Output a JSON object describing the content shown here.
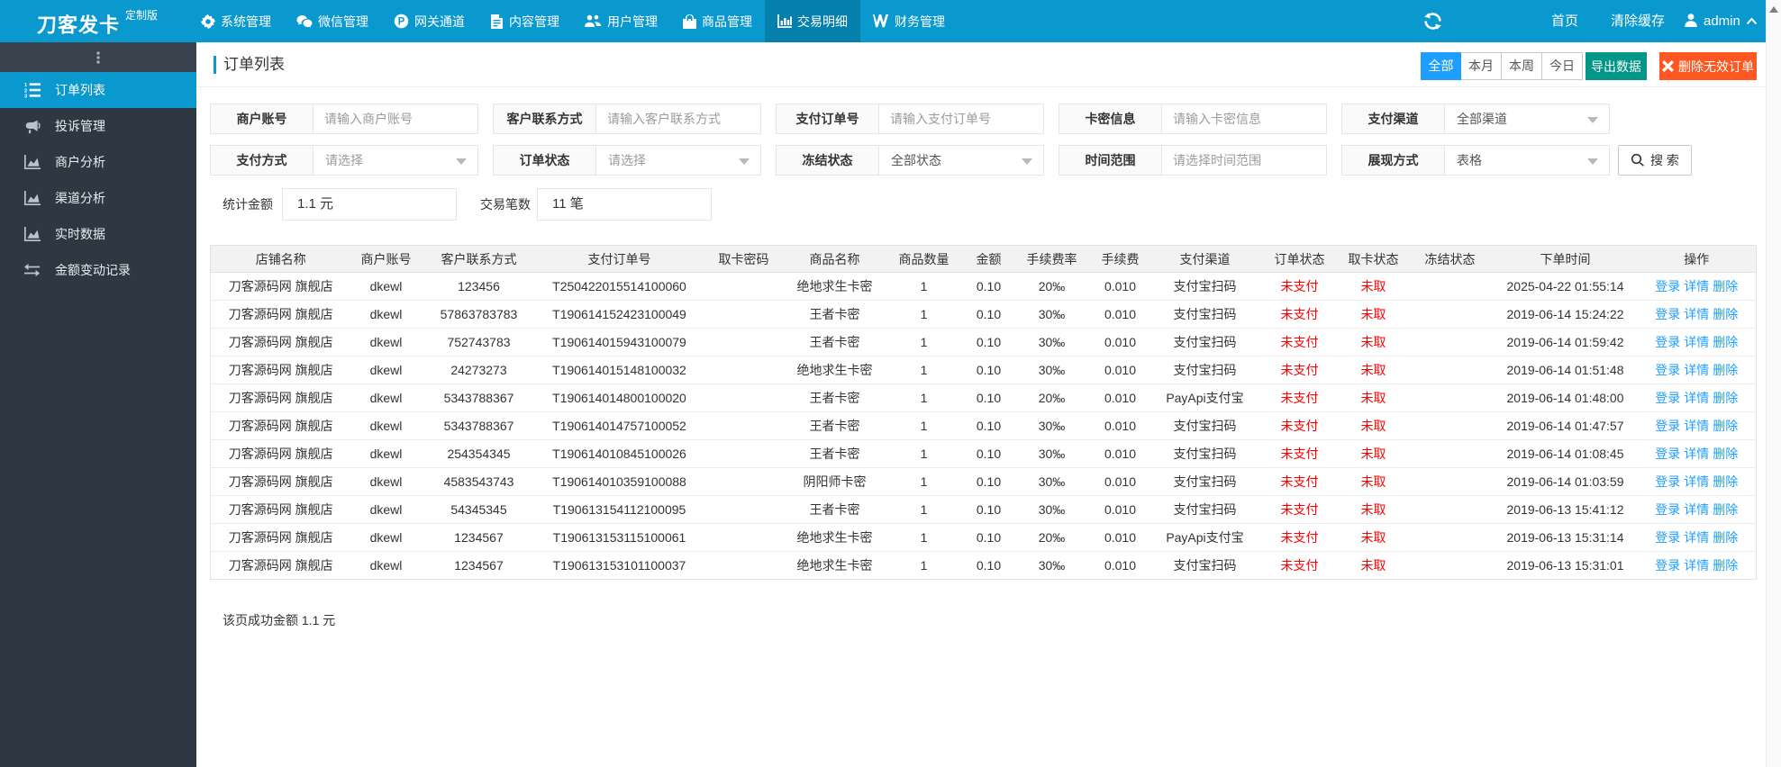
{
  "topbar": {
    "logo": "刀客发卡",
    "logo_badge": "定制版",
    "nav": [
      {
        "label": "系统管理",
        "icon": "gear-icon",
        "active": false
      },
      {
        "label": "微信管理",
        "icon": "wechat-icon",
        "active": false
      },
      {
        "label": "网关通道",
        "icon": "gateway-p-icon",
        "active": false
      },
      {
        "label": "内容管理",
        "icon": "document-icon",
        "active": false
      },
      {
        "label": "用户管理",
        "icon": "users-icon",
        "active": false
      },
      {
        "label": "商品管理",
        "icon": "shopping-bag-icon",
        "active": false
      },
      {
        "label": "交易明细",
        "icon": "bar-chart-icon",
        "active": true
      },
      {
        "label": "财务管理",
        "icon": "finance-icon",
        "active": false
      }
    ],
    "right": {
      "home": "首页",
      "clear_cache": "清除缓存",
      "username": "admin"
    }
  },
  "sidebar": {
    "items": [
      {
        "label": "订单列表",
        "icon": "ordered-list-icon",
        "active": true
      },
      {
        "label": "投诉管理",
        "icon": "megaphone-icon",
        "active": false
      },
      {
        "label": "商户分析",
        "icon": "area-chart-icon",
        "active": false
      },
      {
        "label": "渠道分析",
        "icon": "area-chart-icon",
        "active": false
      },
      {
        "label": "实时数据",
        "icon": "area-chart-icon",
        "active": false
      },
      {
        "label": "金额变动记录",
        "icon": "exchange-icon",
        "active": false
      }
    ]
  },
  "page": {
    "title": "订单列表",
    "range_tabs": [
      {
        "label": "全部",
        "active": true
      },
      {
        "label": "本月",
        "active": false
      },
      {
        "label": "本周",
        "active": false
      },
      {
        "label": "今日",
        "active": false
      }
    ],
    "export_label": "导出数据",
    "delete_label": "删除无效订单",
    "search_label": "搜 索",
    "filters_row1": [
      {
        "label": "商户账号",
        "type": "input",
        "placeholder": "请输入商户账号",
        "value": ""
      },
      {
        "label": "客户联系方式",
        "type": "input",
        "placeholder": "请输入客户联系方式",
        "value": ""
      },
      {
        "label": "支付订单号",
        "type": "input",
        "placeholder": "请输入支付订单号",
        "value": ""
      },
      {
        "label": "卡密信息",
        "type": "input",
        "placeholder": "请输入卡密信息",
        "value": ""
      },
      {
        "label": "支付渠道",
        "type": "select",
        "value": "全部渠道",
        "placeholder_style": false
      }
    ],
    "filters_row2": [
      {
        "label": "支付方式",
        "type": "select",
        "value": "请选择",
        "placeholder_style": true
      },
      {
        "label": "订单状态",
        "type": "select",
        "value": "请选择",
        "placeholder_style": true
      },
      {
        "label": "冻结状态",
        "type": "select",
        "value": "全部状态",
        "placeholder_style": false
      },
      {
        "label": "时间范围",
        "type": "input",
        "placeholder": "请选择时间范围",
        "value": ""
      },
      {
        "label": "展现方式",
        "type": "select",
        "value": "表格",
        "placeholder_style": false
      }
    ],
    "stats": [
      {
        "label": "统计金额",
        "value": "1.1 元"
      },
      {
        "label": "交易笔数",
        "value": "11 笔"
      }
    ],
    "footer_summary": "该页成功金额 1.1 元"
  },
  "table": {
    "columns": [
      "店铺名称",
      "商户账号",
      "客户联系方式",
      "支付订单号",
      "取卡密码",
      "商品名称",
      "商品数量",
      "金额",
      "手续费率",
      "手续费",
      "支付渠道",
      "订单状态",
      "取卡状态",
      "冻结状态",
      "下单时间",
      "操作"
    ],
    "actions": [
      "登录",
      "详情",
      "删除"
    ],
    "rows": [
      [
        "刀客源码网 旗舰店",
        "dkewl",
        "123456",
        "T250422015514100060",
        "",
        "绝地求生卡密",
        "1",
        "0.10",
        "20‰",
        "0.010",
        "支付宝扫码",
        "未支付",
        "未取",
        "",
        "2025-04-22 01:55:14"
      ],
      [
        "刀客源码网 旗舰店",
        "dkewl",
        "57863783783",
        "T190614152423100049",
        "",
        "王者卡密",
        "1",
        "0.10",
        "30‰",
        "0.010",
        "支付宝扫码",
        "未支付",
        "未取",
        "",
        "2019-06-14 15:24:22"
      ],
      [
        "刀客源码网 旗舰店",
        "dkewl",
        "752743783",
        "T190614015943100079",
        "",
        "王者卡密",
        "1",
        "0.10",
        "30‰",
        "0.010",
        "支付宝扫码",
        "未支付",
        "未取",
        "",
        "2019-06-14 01:59:42"
      ],
      [
        "刀客源码网 旗舰店",
        "dkewl",
        "24273273",
        "T190614015148100032",
        "",
        "绝地求生卡密",
        "1",
        "0.10",
        "30‰",
        "0.010",
        "支付宝扫码",
        "未支付",
        "未取",
        "",
        "2019-06-14 01:51:48"
      ],
      [
        "刀客源码网 旗舰店",
        "dkewl",
        "5343788367",
        "T190614014800100020",
        "",
        "王者卡密",
        "1",
        "0.10",
        "20‰",
        "0.010",
        "PayApi支付宝",
        "未支付",
        "未取",
        "",
        "2019-06-14 01:48:00"
      ],
      [
        "刀客源码网 旗舰店",
        "dkewl",
        "5343788367",
        "T190614014757100052",
        "",
        "王者卡密",
        "1",
        "0.10",
        "30‰",
        "0.010",
        "支付宝扫码",
        "未支付",
        "未取",
        "",
        "2019-06-14 01:47:57"
      ],
      [
        "刀客源码网 旗舰店",
        "dkewl",
        "254354345",
        "T190614010845100026",
        "",
        "王者卡密",
        "1",
        "0.10",
        "30‰",
        "0.010",
        "支付宝扫码",
        "未支付",
        "未取",
        "",
        "2019-06-14 01:08:45"
      ],
      [
        "刀客源码网 旗舰店",
        "dkewl",
        "4583543743",
        "T190614010359100088",
        "",
        "阴阳师卡密",
        "1",
        "0.10",
        "30‰",
        "0.010",
        "支付宝扫码",
        "未支付",
        "未取",
        "",
        "2019-06-14 01:03:59"
      ],
      [
        "刀客源码网 旗舰店",
        "dkewl",
        "54345345",
        "T190613154112100095",
        "",
        "王者卡密",
        "1",
        "0.10",
        "30‰",
        "0.010",
        "支付宝扫码",
        "未支付",
        "未取",
        "",
        "2019-06-13 15:41:12"
      ],
      [
        "刀客源码网 旗舰店",
        "dkewl",
        "1234567",
        "T190613153115100061",
        "",
        "绝地求生卡密",
        "1",
        "0.10",
        "20‰",
        "0.010",
        "PayApi支付宝",
        "未支付",
        "未取",
        "",
        "2019-06-13 15:31:14"
      ],
      [
        "刀客源码网 旗舰店",
        "dkewl",
        "1234567",
        "T190613153101100037",
        "",
        "绝地求生卡密",
        "1",
        "0.10",
        "30‰",
        "0.010",
        "支付宝扫码",
        "未支付",
        "未取",
        "",
        "2019-06-13 15:31:01"
      ]
    ]
  },
  "colors": {
    "topbar_blue": "#0a99ce",
    "nav_active_blue": "#0580ad",
    "sidebar_dark": "#2e3842",
    "sidebar_strip": "#39434e",
    "primary_button_blue": "#1E9FFF",
    "export_green": "#009688",
    "delete_orange": "#FF5722",
    "status_red": "#ff0000",
    "link_blue": "#1E9FFF"
  }
}
